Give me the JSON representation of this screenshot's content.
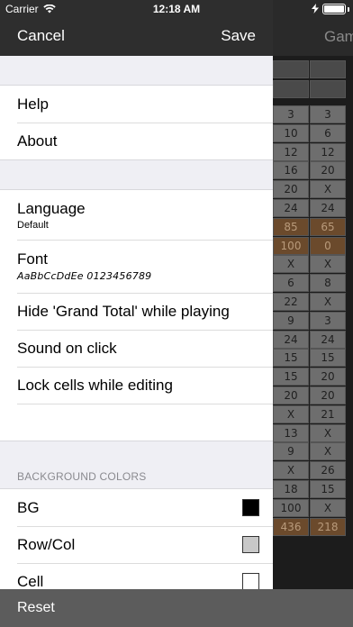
{
  "status_bar": {
    "carrier": "Carrier",
    "time": "12:18 AM"
  },
  "nav": {
    "cancel": "Cancel",
    "save": "Save"
  },
  "background": {
    "title": "Gam",
    "grid": [
      [
        "3",
        "3"
      ],
      [
        "10",
        "6"
      ],
      [
        "12",
        "12"
      ],
      [
        "16",
        "20"
      ],
      [
        "20",
        "X"
      ],
      [
        "24",
        "24"
      ],
      [
        "85",
        "65"
      ],
      [
        "100",
        "0"
      ],
      [
        "X",
        "X"
      ],
      [
        "6",
        "8"
      ],
      [
        "22",
        "X"
      ],
      [
        "9",
        "3"
      ],
      [
        "24",
        "24"
      ],
      [
        "15",
        "15"
      ],
      [
        "15",
        "20"
      ],
      [
        "20",
        "20"
      ],
      [
        "X",
        "21"
      ],
      [
        "13",
        "X"
      ],
      [
        "9",
        "X"
      ],
      [
        "X",
        "26"
      ],
      [
        "18",
        "15"
      ],
      [
        "100",
        "X"
      ],
      [
        "436",
        "218"
      ]
    ]
  },
  "menu": {
    "help": "Help",
    "about": "About",
    "language": {
      "label": "Language",
      "value": "Default"
    },
    "font": {
      "label": "Font",
      "sample": "AaBbCcDdEe 0123456789"
    },
    "hide_grand_total": "Hide 'Grand Total' while playing",
    "sound_on_click": "Sound on click",
    "lock_cells": "Lock cells while editing"
  },
  "background_colors": {
    "header": "BACKGROUND COLORS",
    "items": [
      {
        "label": "BG",
        "color": "#000000"
      },
      {
        "label": "Row/Col",
        "color": "#c8c8c8"
      },
      {
        "label": "Cell",
        "color": "#ffffff"
      }
    ]
  },
  "footer": {
    "reset": "Reset"
  }
}
